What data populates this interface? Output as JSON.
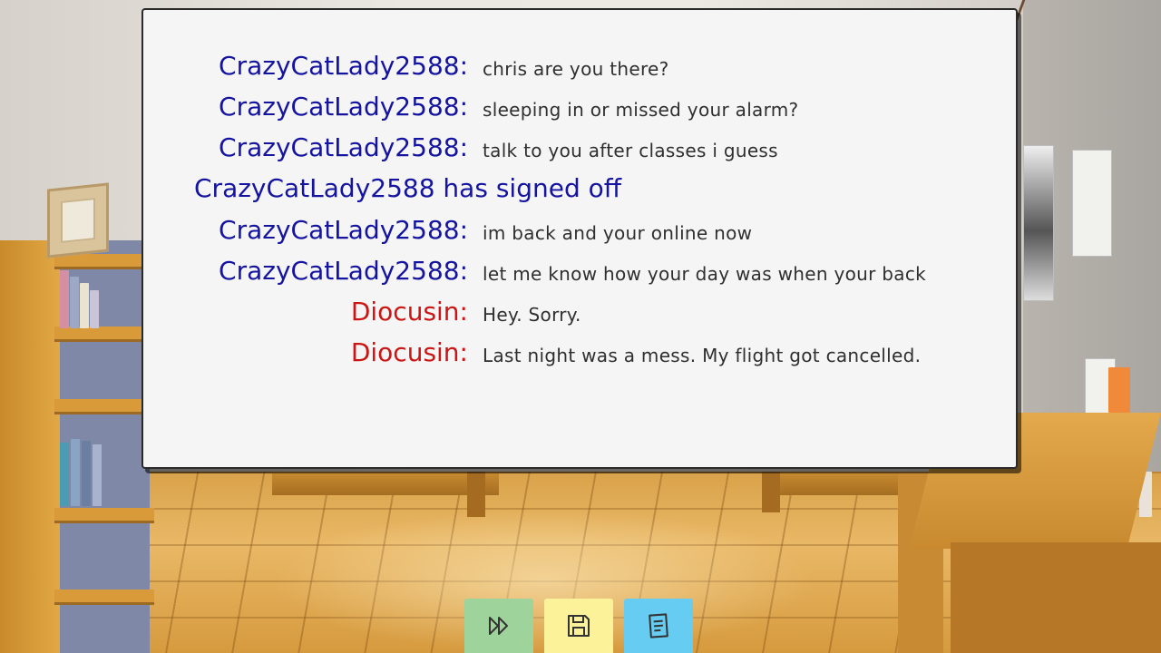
{
  "chat": {
    "lines": [
      {
        "speaker": "CrazyCatLady2588:",
        "message": "chris are you there?"
      },
      {
        "speaker": "CrazyCatLady2588:",
        "message": "sleeping in or missed your alarm?"
      },
      {
        "speaker": "CrazyCatLady2588:",
        "message": "talk to you after classes i guess"
      },
      {
        "system": "CrazyCatLady2588 has signed off"
      },
      {
        "speaker": "CrazyCatLady2588:",
        "message": "im back and your online now"
      },
      {
        "speaker": "CrazyCatLady2588:",
        "message": "let me know how your day was when your back"
      },
      {
        "speaker": "Diocusin:",
        "message": "Hey. Sorry."
      },
      {
        "speaker": "Diocusin:",
        "message": "Last night was a mess. My flight got cancelled."
      }
    ]
  },
  "colors": {
    "crazycat": "#1414a0",
    "diocusin": "#cc1515",
    "message_text": "#2f2f2f",
    "panel_bg": "#f5f5f5"
  },
  "toolbar": {
    "buttons": [
      {
        "icon": "fast-forward-icon",
        "color": "#9fd39c"
      },
      {
        "icon": "save-icon",
        "color": "#fbf29a"
      },
      {
        "icon": "log-icon",
        "color": "#66ccf2"
      }
    ]
  }
}
